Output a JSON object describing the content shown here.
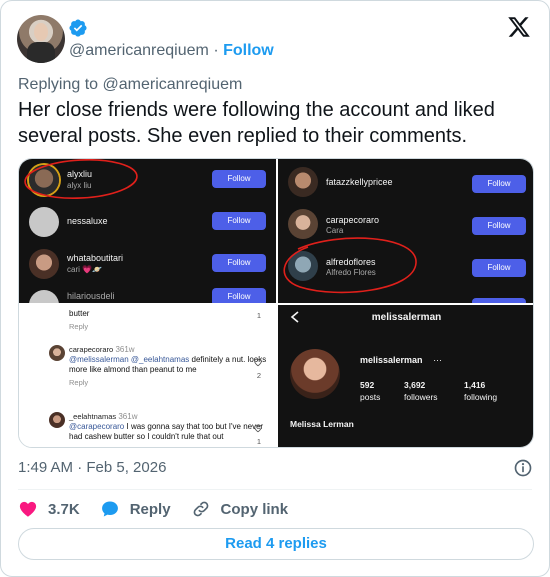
{
  "tweet": {
    "handle": "@americanreqiuem",
    "separator": "·",
    "follow_label": "Follow",
    "reply_to": "Replying to @americanreqiuem",
    "text": "Her close friends were following the account and liked several posts. She even replied to their comments.",
    "timestamp": "1:49 AM · Feb 5, 2026",
    "likes": "3.7K",
    "reply_label": "Reply",
    "copy_label": "Copy link",
    "read_replies": "Read 4 replies"
  },
  "media": {
    "panel1": {
      "rows": [
        {
          "name": "alyxliu",
          "sub": "alyx liu",
          "button": "Follow"
        },
        {
          "name": "nessaluxe",
          "sub": "",
          "button": "Follow"
        },
        {
          "name": "whataboutitari",
          "sub": "cari 💗🪐",
          "button": "Follow"
        },
        {
          "name": "hilariousdeli",
          "sub": "",
          "button": "Follow"
        }
      ]
    },
    "panel2": {
      "rows": [
        {
          "name": "fatazzkellypricee",
          "sub": "",
          "button": "Follow"
        },
        {
          "name": "carapecoraro",
          "sub": "Cara",
          "button": "Follow"
        },
        {
          "name": "alfredoflores",
          "sub": "Alfredo Flores",
          "button": "Follow"
        }
      ]
    },
    "panel3": {
      "top_text": "butter",
      "top_likes": "1",
      "reply": "Reply",
      "c1_user": "carapecoraro",
      "c1_time": "361w",
      "c1_mention": "@melissalerman @_eelahtnamas",
      "c1_text": "definitely a nut. looks more like almond than peanut to me",
      "c1_likes": "2",
      "c2_user": "_eelahtnamas",
      "c2_time": "361w",
      "c2_mention": "@carapecoraro",
      "c2_text": "I was gonna say that too but I've never had cashew butter so I couldn't rule that out",
      "c2_likes": "1"
    },
    "panel4": {
      "title": "melissalerman",
      "username": "melissalerman",
      "more": "···",
      "posts": "592",
      "posts_label": "posts",
      "followers": "3,692",
      "followers_label": "followers",
      "following": "1,416",
      "following_label": "following",
      "full_name": "Melissa Lerman"
    }
  },
  "colors": {
    "accent": "#1d9bf0",
    "like": "#f91880",
    "ig_button": "#4d5fe8",
    "circle": "#e0201b"
  }
}
